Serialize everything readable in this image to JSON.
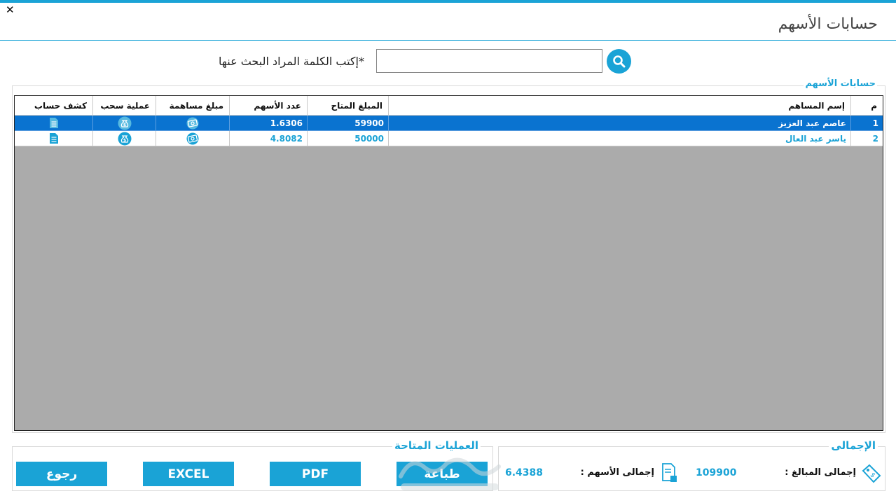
{
  "window": {
    "close_glyph": "✕",
    "title": "حسابات الأسهم"
  },
  "search": {
    "label": "*إكتب الكلمة المراد البحث عنها",
    "value": "",
    "placeholder": "",
    "button_icon": "search-icon"
  },
  "grid": {
    "group_title": "حسابات الأسهم",
    "columns": [
      "م",
      "إسم المساهم",
      "المبلغ المتاح",
      "عدد الأسهم",
      "مبلغ مساهمة",
      "عملية سحب",
      "كشف حساب"
    ],
    "rows": [
      {
        "num": "1",
        "name": "عاصم عبد العزيز",
        "available": "59900",
        "shares": "1.6306",
        "selected": true
      },
      {
        "num": "2",
        "name": "ياسر عبد العال",
        "available": "50000",
        "shares": "4.8082",
        "selected": false
      }
    ],
    "row_icons": {
      "contribution": "money-icon",
      "withdraw": "money-bag-icon",
      "statement": "document-icon"
    }
  },
  "operations": {
    "group_title": "العمليات المتاحة",
    "print_label": "طباعة",
    "pdf_label": "PDF",
    "excel_label": "EXCEL",
    "back_label": "رجوع"
  },
  "totals": {
    "group_title": "الإجمالى",
    "amounts_label": "إجمالى المبالغ :",
    "amounts_value": "109900",
    "shares_label": "إجمالى الأسهم :",
    "shares_value": "6.4388"
  },
  "colors": {
    "accent": "#1aa3d6",
    "selected_row": "#0a73d0",
    "grid_background": "#ababab"
  }
}
